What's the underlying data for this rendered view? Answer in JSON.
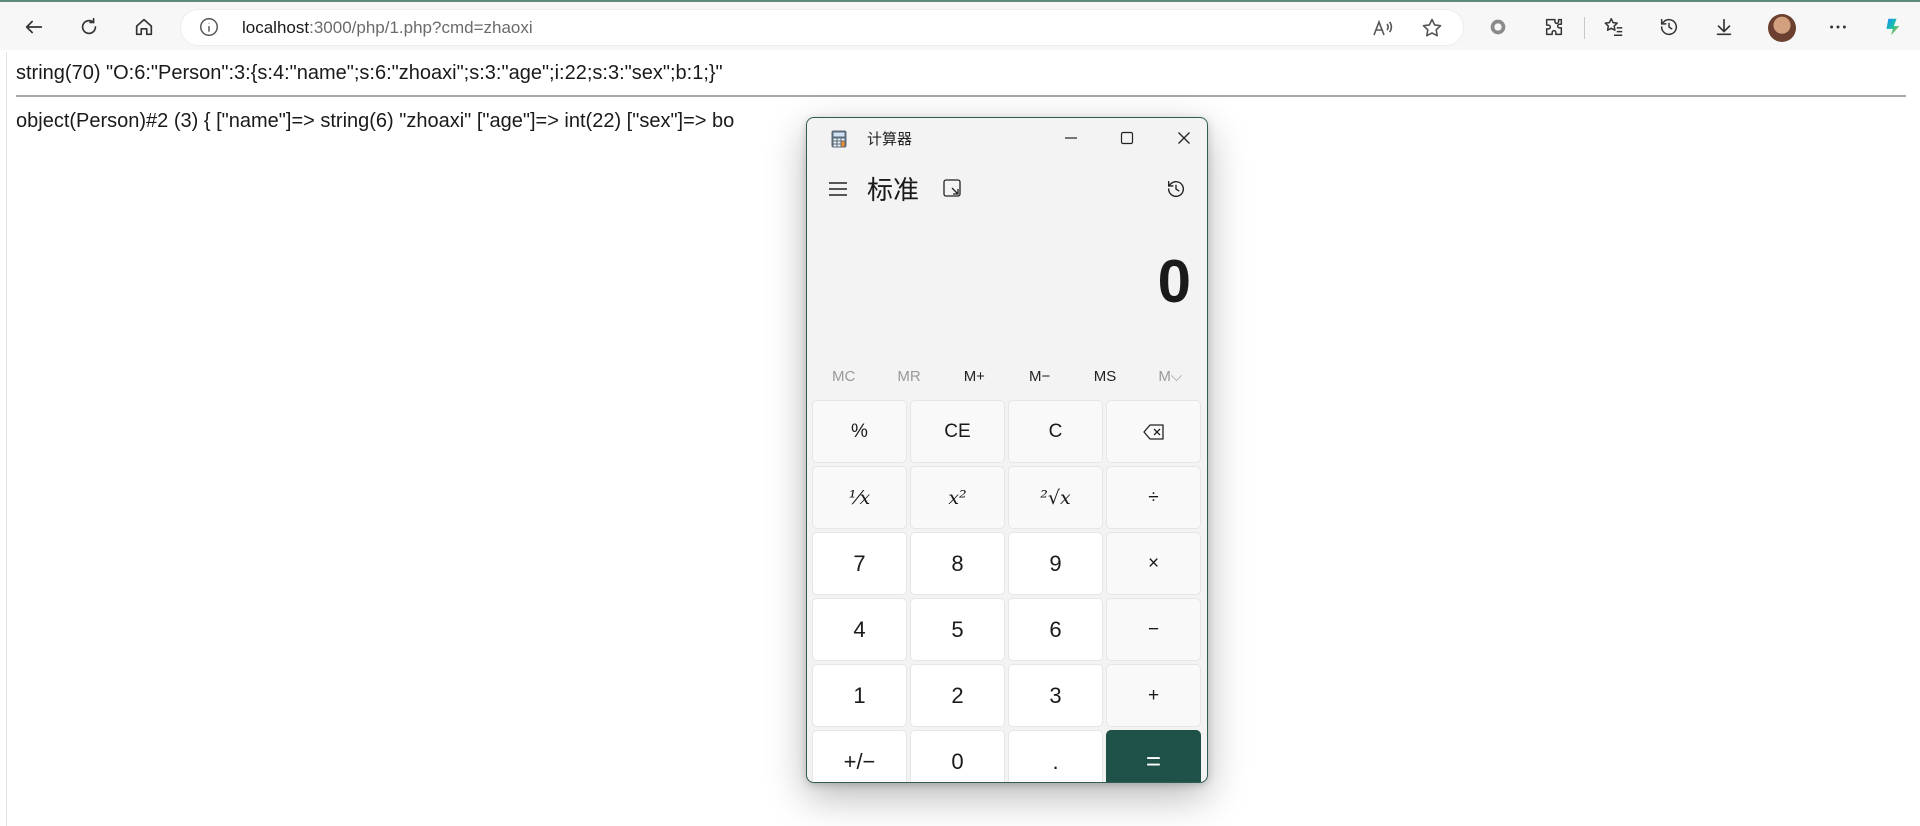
{
  "browser": {
    "url_host": "localhost",
    "url_rest": ":3000/php/1.php?cmd=zhaoxi",
    "accent_color": "#5d8a7a"
  },
  "page": {
    "line1": "string(70) \"O:6:\"Person\":3:{s:4:\"name\";s:6:\"zhoaxi\";s:3:\"age\";i:22;s:3:\"sex\";b:1;}\"",
    "line2": "object(Person)#2 (3) { [\"name\"]=> string(6) \"zhoaxi\" [\"age\"]=> int(22) [\"sex\"]=> bo"
  },
  "calculator": {
    "window_title": "计算器",
    "mode_title": "标准",
    "display_value": "0",
    "accent_color": "#1e5147",
    "memory": [
      {
        "label": "MC",
        "enabled": false
      },
      {
        "label": "MR",
        "enabled": false
      },
      {
        "label": "M+",
        "enabled": true
      },
      {
        "label": "M−",
        "enabled": true
      },
      {
        "label": "MS",
        "enabled": true
      },
      {
        "label": "M⌵",
        "enabled": false
      }
    ],
    "keys": {
      "percent": "%",
      "ce": "CE",
      "c": "C",
      "reciprocal": "¹⁄x",
      "square": "x²",
      "sqrt": "²√x",
      "divide": "÷",
      "seven": "7",
      "eight": "8",
      "nine": "9",
      "multiply": "×",
      "four": "4",
      "five": "5",
      "six": "6",
      "minus": "−",
      "one": "1",
      "two": "2",
      "three": "3",
      "plus": "+",
      "negate": "+/−",
      "zero": "0",
      "decimal": ".",
      "equals": "="
    }
  }
}
